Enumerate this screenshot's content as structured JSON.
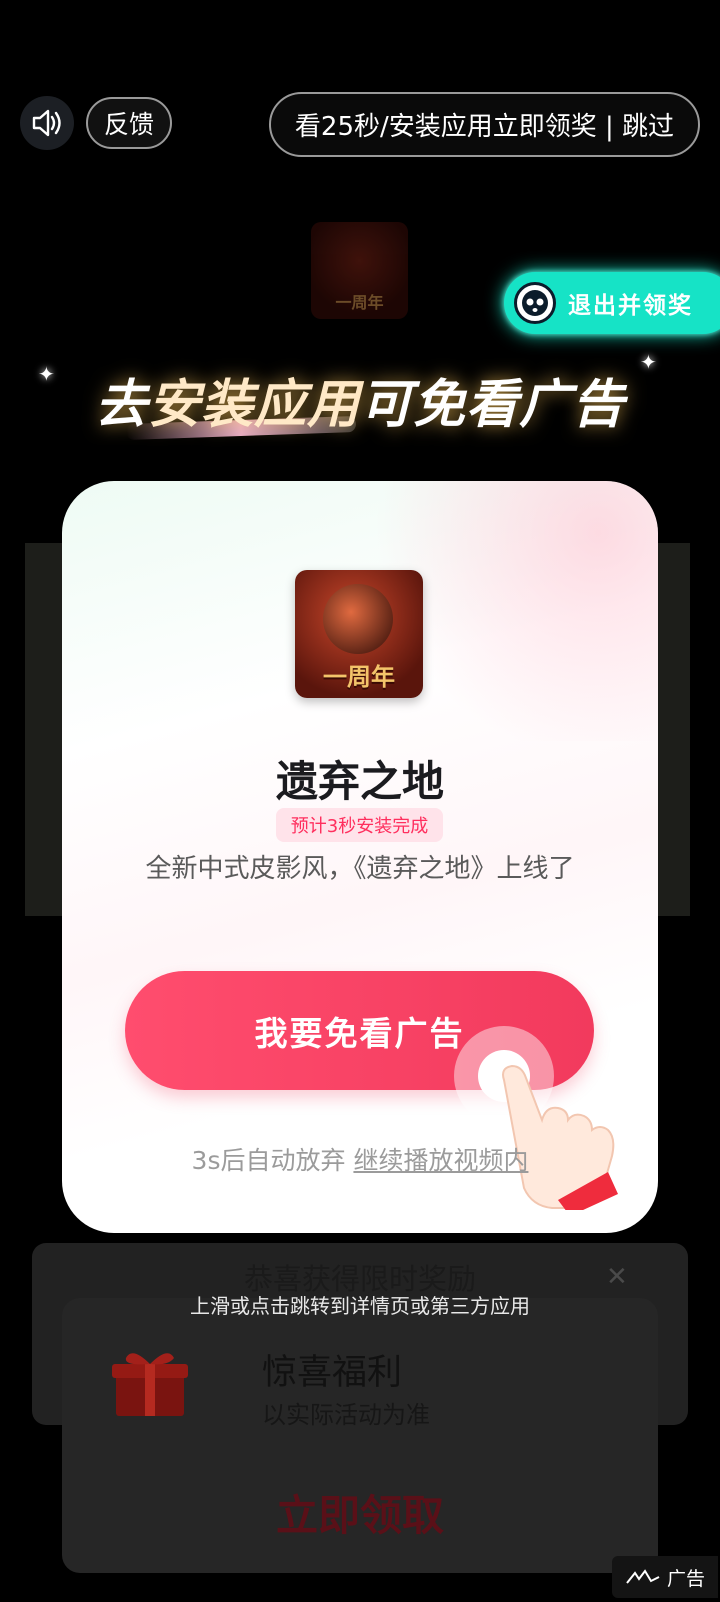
{
  "top_bar": {
    "volume_icon": "speaker-icon",
    "feedback_label": "反馈",
    "skip_label": "看25秒/安装应用立即领奖 | 跳过"
  },
  "background": {
    "small_icon_text": "一周年"
  },
  "exit_pill": {
    "icon": "ghost-face-icon",
    "label": "退出并领奖"
  },
  "headline": {
    "part1": "去",
    "part2": "安装应用",
    "part3": "可免看广告"
  },
  "card": {
    "app_icon_banner": "一周年",
    "app_name": "遗弃之地",
    "install_badge": "预计3秒安装完成",
    "description": "全新中式皮影风，《遗弃之地》上线了",
    "cta_label": "我要免看广告",
    "giveup_prefix": "3s后自动放弃",
    "giveup_link": "继续播放视频内"
  },
  "reward_overlay": {
    "title": "恭喜获得限时奖励",
    "swipe_hint": "上滑或点击跳转到详情页或第三方应用",
    "welfare_title": "惊喜福利",
    "welfare_subtitle": "以实际活动为准",
    "claim_label": "立即领取"
  },
  "ad_tag": {
    "label": "广告"
  },
  "colors": {
    "accent": "#f23a5d",
    "teal": "#16e3c6",
    "background": "#000000"
  }
}
